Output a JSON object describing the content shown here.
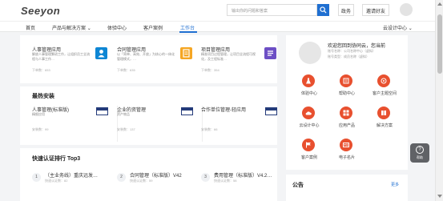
{
  "header": {
    "logo_main": "Seeyon",
    "search_placeholder": "输出你的问题和答案",
    "btn_policy": "政务",
    "btn_invite": "邀请好友"
  },
  "nav": {
    "items": [
      "首页",
      "产品与解决方案",
      "体验中心",
      "客户案例",
      "工作台"
    ],
    "active_index": 4,
    "right_link": "云设计中心"
  },
  "apps": [
    {
      "title": "人事管理应用",
      "desc": "解放人事管理繁琐工作，让组织员工全流程与人事工作…",
      "count": "下单数：653"
    },
    {
      "title": "合同管理应用",
      "desc": "以「简单、高效、开放」为核心的一体化管理模式，…",
      "count": "下单数：635"
    },
    {
      "title": "项目管理应用",
      "desc": "精准项目过程管理，让项目全流程可视化，及工程标准…",
      "count": "下单数：354"
    }
  ],
  "hot": {
    "title": "最热安装",
    "items": [
      {
        "title": "人事管理(标准版)",
        "desc": "精细应用",
        "count": "安装数：99"
      },
      {
        "title": "企业的资管理",
        "desc": "资产物品",
        "count": "安装数：137"
      },
      {
        "title": "合作单位管理-轻应用",
        "desc": "",
        "count": "安装数：66"
      }
    ]
  },
  "rank": {
    "title": "快速认证排行 Top3",
    "items": [
      {
        "num": "1",
        "title": "（主业务线）重庆远发…",
        "count": "快速认证数：82"
      },
      {
        "num": "2",
        "title": "合同管理（标准版）V42",
        "count": "快速认证数：59"
      },
      {
        "num": "3",
        "title": "费用管理（标准版）V4.2…",
        "count": "快速认证数：58"
      }
    ]
  },
  "user": {
    "greeting": "欢迎您回到协同云，您当前",
    "line1": "账号名称：公司名称中心（虚拟）",
    "line2": "账号类型：成员名称（虚拟）"
  },
  "quick": [
    {
      "label": "体验中心",
      "icon": "flask-icon"
    },
    {
      "label": "帮助中心",
      "icon": "help-icon"
    },
    {
      "label": "客户主题空间",
      "icon": "space-icon"
    },
    {
      "label": "云设计中心",
      "icon": "cloud-icon"
    },
    {
      "label": "应用产品",
      "icon": "grid-icon"
    },
    {
      "label": "解决方案",
      "icon": "book-icon"
    },
    {
      "label": "客户案例",
      "icon": "flag-icon"
    },
    {
      "label": "电子名片",
      "icon": "card-icon"
    }
  ],
  "notice": {
    "title": "公告",
    "more": "更多"
  },
  "float_help": {
    "label": "帮助"
  },
  "colors": {
    "accent": "#1f6fd1",
    "quick_icon": "#e8502f",
    "app_icons": [
      "#0e86d4",
      "#f5a623",
      "#6d4fc5"
    ]
  }
}
